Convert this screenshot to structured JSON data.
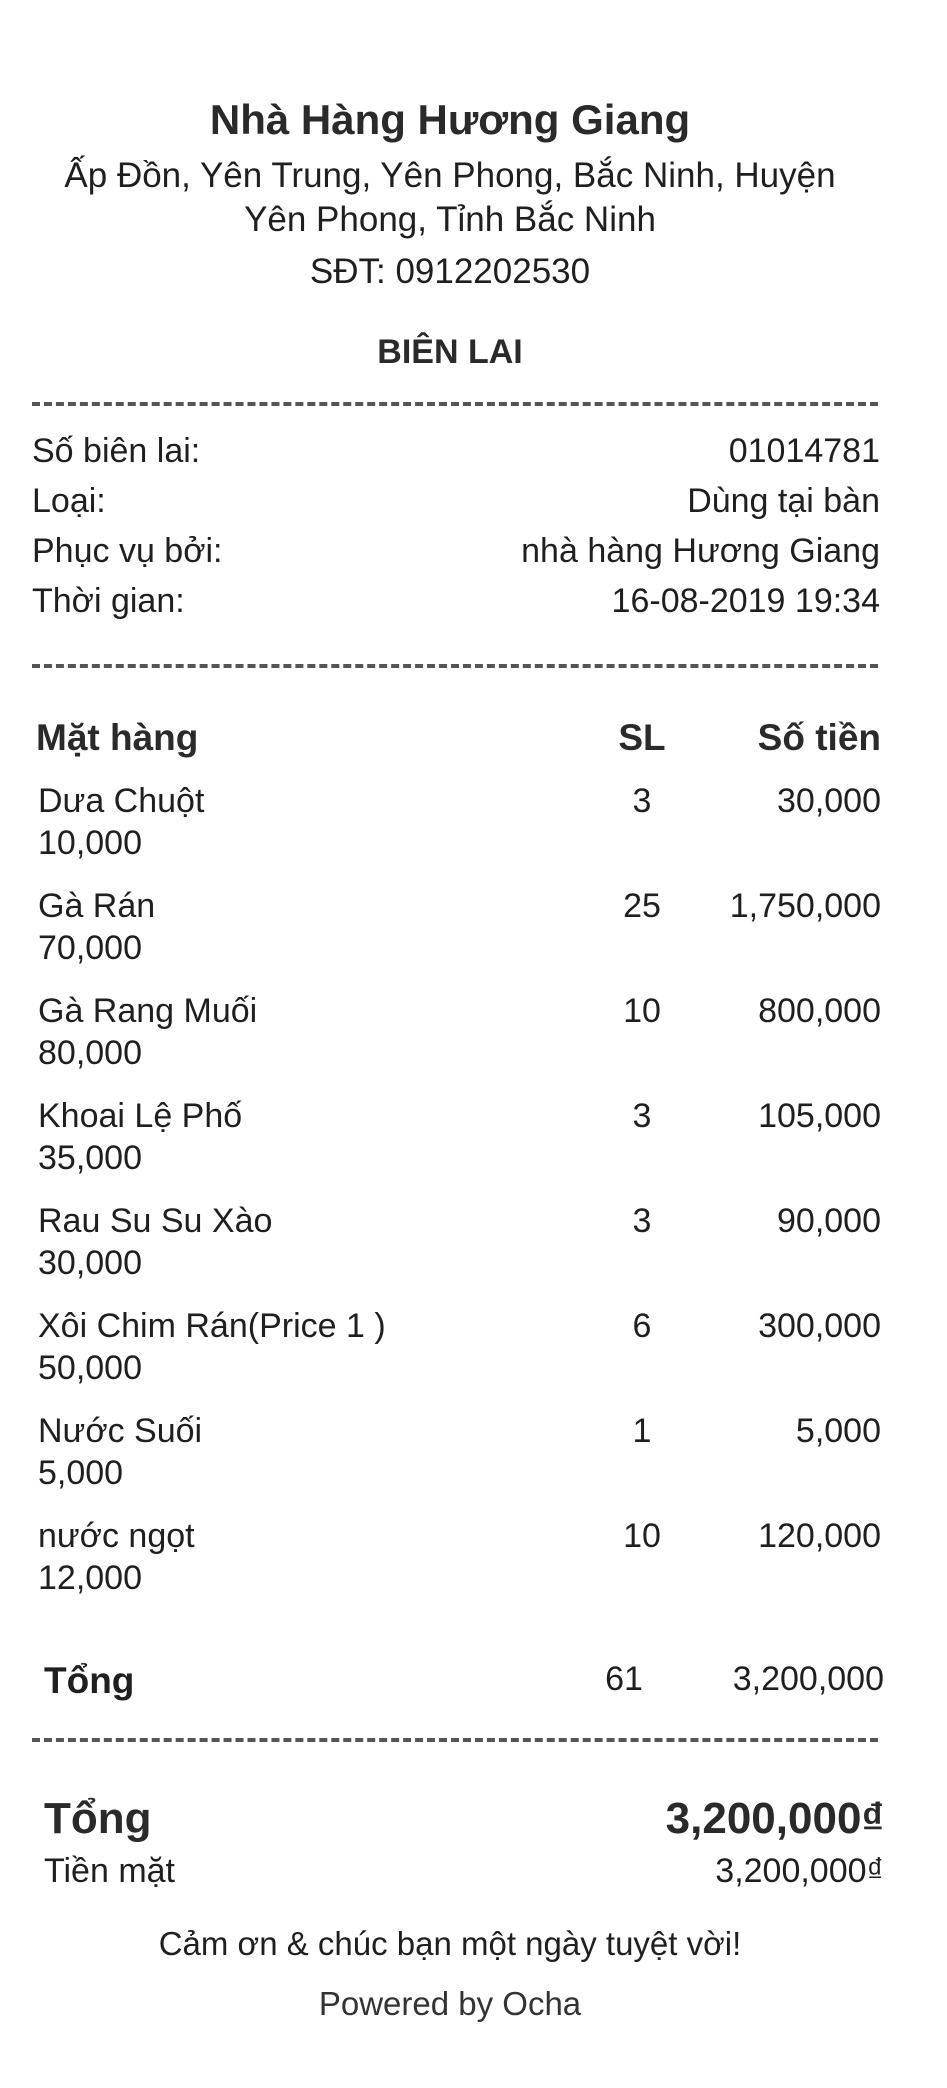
{
  "store": {
    "name": "Nhà Hàng Hương Giang",
    "address": "Ấp Đồn, Yên Trung, Yên Phong, Bắc Ninh, Huyện Yên Phong, Tỉnh Bắc Ninh",
    "phone": "SĐT: 0912202530"
  },
  "title": "BIÊN LAI",
  "info": [
    {
      "label": "Số biên lai:",
      "value": "01014781"
    },
    {
      "label": "Loại:",
      "value": "Dùng tại bàn"
    },
    {
      "label": "Phục vụ bởi:",
      "value": "nhà hàng Hương Giang"
    },
    {
      "label": "Thời gian:",
      "value": "16-08-2019 19:34"
    }
  ],
  "columns": {
    "item": "Mặt hàng",
    "qty": "SL",
    "amount": "Số tiền"
  },
  "items": [
    {
      "name": "Dưa Chuột",
      "unit_price": "10,000",
      "qty": "3",
      "amount": "30,000"
    },
    {
      "name": "Gà Rán",
      "unit_price": "70,000",
      "qty": "25",
      "amount": "1,750,000"
    },
    {
      "name": "Gà Rang Muối",
      "unit_price": "80,000",
      "qty": "10",
      "amount": "800,000"
    },
    {
      "name": "Khoai Lệ Phố",
      "unit_price": "35,000",
      "qty": "3",
      "amount": "105,000"
    },
    {
      "name": "Rau Su Su Xào",
      "unit_price": "30,000",
      "qty": "3",
      "amount": "90,000"
    },
    {
      "name": "Xôi Chim Rán(Price 1 )",
      "unit_price": "50,000",
      "qty": "6",
      "amount": "300,000"
    },
    {
      "name": "Nước Suối",
      "unit_price": "5,000",
      "qty": "1",
      "amount": "5,000"
    },
    {
      "name": "nước ngọt",
      "unit_price": "12,000",
      "qty": "10",
      "amount": "120,000"
    }
  ],
  "subtotal": {
    "label": "Tổng",
    "qty": "61",
    "amount": "3,200,000"
  },
  "grand_total": {
    "label": "Tổng",
    "amount": "3,200,000₫"
  },
  "cash": {
    "label": "Tiền mặt",
    "amount": "3,200,000₫"
  },
  "footer": {
    "thanks": "Cảm ơn & chúc bạn một ngày tuyệt vời!",
    "powered": "Powered by Ocha"
  }
}
